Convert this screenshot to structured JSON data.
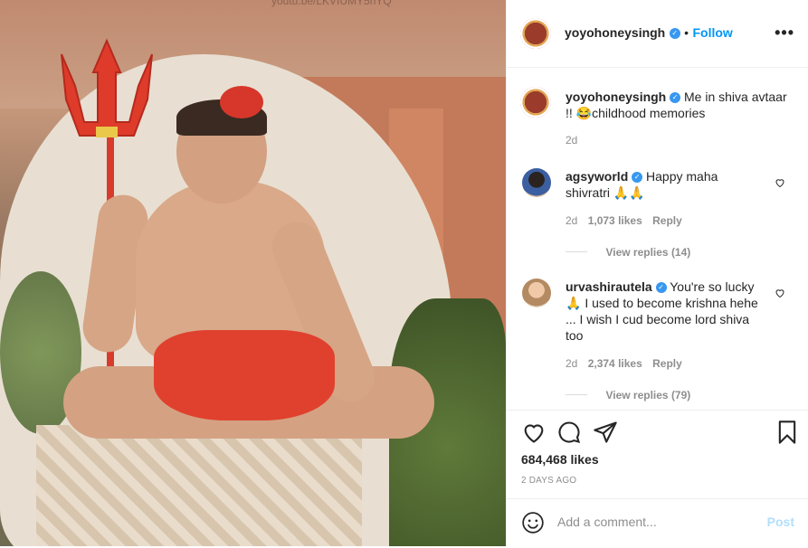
{
  "watermark": "youtu.be/LKVIUMY5hYQ",
  "header": {
    "username": "yoyohoneysingh",
    "dot": "•",
    "follow_label": "Follow",
    "more": "•••"
  },
  "caption": {
    "username": "yoyohoneysingh",
    "text_line1": "Me in shiva avtaar",
    "text_line2": "!! 😂childhood memories",
    "time": "2d"
  },
  "comments": [
    {
      "username": "agsyworld",
      "text": "Happy maha",
      "text2": "shivratri 🙏🙏",
      "time": "2d",
      "likes": "1,073 likes",
      "reply": "Reply",
      "view_replies": "View replies (14)"
    },
    {
      "username": "urvashirautela",
      "text": "You're so lucky",
      "text2": "🙏 I used to become krishna hehe",
      "text3": "... I wish I cud become lord shiva",
      "text4": "too",
      "time": "2d",
      "likes": "2,374 likes",
      "reply": "Reply",
      "view_replies": "View replies (79)"
    }
  ],
  "post": {
    "likes": "684,468 likes",
    "ago": "2 DAYS AGO"
  },
  "add_comment": {
    "placeholder": "Add a comment...",
    "post_label": "Post"
  },
  "colors": {
    "accent": "#0095f6",
    "verified": "#3897f0",
    "post_disabled": "#b2dffc"
  }
}
